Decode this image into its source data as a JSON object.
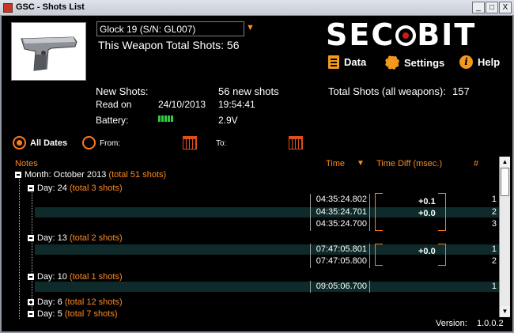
{
  "window": {
    "title": "GSC - Shots List",
    "minimize": "_",
    "maximize": "□",
    "close": "X"
  },
  "weapon": {
    "selected": "Glock 19 (S/N: GL007)",
    "total_label": "This Weapon Total Shots:",
    "total_value": "56"
  },
  "logo": {
    "left": "SEC",
    "right": "BIT"
  },
  "nav": {
    "data": "Data",
    "settings": "Settings",
    "help": "Help"
  },
  "stats": {
    "new_shots_label": "New Shots:",
    "new_shots_value": "56 new shots",
    "total_all_label": "Total Shots (all weapons):",
    "total_all_value": "157",
    "read_on_label": "Read on",
    "read_date": "24/10/2013",
    "read_time": "19:54:41",
    "battery_label": "Battery:",
    "battery_value": "2.9V",
    "battery_level": 1.0
  },
  "filters": {
    "all_dates": "All Dates",
    "from": "From:",
    "to": "To:"
  },
  "columns": {
    "notes": "Notes",
    "time": "Time",
    "time_diff": "Time Diff",
    "msec": "(msec.)",
    "number": "#"
  },
  "tree": {
    "month": {
      "label": "Month: October 2013",
      "total": "(total 51 shots)"
    },
    "day24": {
      "label": "Day: 24",
      "total": "(total 3 shots)",
      "shots": [
        {
          "time": "04:35:24.802",
          "diff": "+0.1",
          "num": "1"
        },
        {
          "time": "04:35:24.701",
          "diff": "+0.0",
          "num": "2"
        },
        {
          "time": "04:35:24.700",
          "diff": "",
          "num": "3"
        }
      ]
    },
    "day13": {
      "label": "Day: 13",
      "total": "(total 2 shots)",
      "shots": [
        {
          "time": "07:47:05.801",
          "diff": "+0.0",
          "num": "1"
        },
        {
          "time": "07:47:05.800",
          "diff": "",
          "num": "2"
        }
      ]
    },
    "day10": {
      "label": "Day: 10",
      "total": "(total 1 shots)",
      "shots": [
        {
          "time": "09:05:06.700",
          "num": "1"
        }
      ]
    },
    "day6": {
      "label": "Day: 6",
      "total": "(total 12 shots)"
    },
    "day5": {
      "label": "Day: 5",
      "total": "(total 7 shots)"
    }
  },
  "footer": {
    "version_label": "Version:",
    "version_value": "1.0.0.2"
  },
  "colors": {
    "accent": "#ff8a1c",
    "logo_red": "#d11a1a",
    "battery": "#2ecc40"
  }
}
